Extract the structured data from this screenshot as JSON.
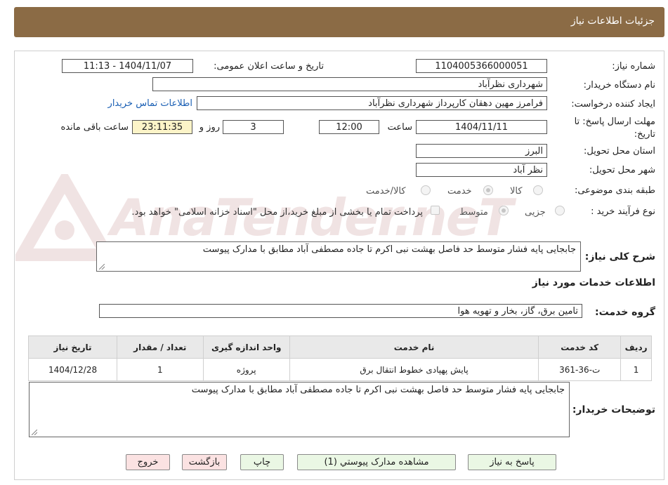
{
  "header": {
    "title": "جزئیات اطلاعات نیاز"
  },
  "form": {
    "need_number": {
      "label": "شماره نیاز:",
      "value": "1104005366000051"
    },
    "announce": {
      "label": "تاریخ و ساعت اعلان عمومی:",
      "value": "1404/11/07 - 11:13"
    },
    "buyer_org": {
      "label": "نام دستگاه خریدار:",
      "value": "شهرداری نظرآباد"
    },
    "requester": {
      "label": "ایجاد کننده درخواست:",
      "value": "فرامرز مهین دهقان کارپرداز شهرداری نظرآباد"
    },
    "contact_link": "اطلاعات تماس خریدار",
    "deadline": {
      "label_line1": "مهلت ارسال پاسخ: تا",
      "label_line2": "تاریخ:",
      "date": "1404/11/11",
      "time_label": "ساعت",
      "time": "12:00",
      "days": "3",
      "days_label": "روز و",
      "remaining": "23:11:35",
      "remaining_label": "ساعت باقی مانده"
    },
    "province": {
      "label": "استان محل تحویل:",
      "value": "البرز"
    },
    "city": {
      "label": "شهر محل تحویل:",
      "value": "نظر آباد"
    },
    "category": {
      "label": "طبقه بندی موضوعی:",
      "options": [
        "کالا",
        "خدمت",
        "کالا/خدمت"
      ],
      "selected": "خدمت"
    },
    "process": {
      "label": "نوع فرآیند خرید :",
      "options": [
        "جزیی",
        "متوسط"
      ],
      "selected": "متوسط",
      "payment_note": "پرداخت تمام یا بخشی از مبلغ خرید،از محل \"اسناد خزانه اسلامی\" خواهد بود."
    },
    "general_desc": {
      "label": "شرح کلی نیاز:",
      "value": "جابجایی پایه فشار متوسط حد فاصل بهشت نبی اکرم تا جاده مصطفی آباد مطابق با مدارک پیوست"
    }
  },
  "services": {
    "section_title": "اطلاعات خدمات مورد نیاز",
    "group_label": "گروه خدمت:",
    "group_value": "تامین برق، گاز، بخار و تهویه هوا",
    "columns": [
      "ردیف",
      "کد خدمت",
      "نام خدمت",
      "واحد اندازه گیری",
      "تعداد / مقدار",
      "تاریخ نیاز"
    ],
    "rows": [
      [
        "1",
        "ت-36-361",
        "پایش پهپادی خطوط انتقال برق",
        "پروژه",
        "1",
        "1404/12/28"
      ]
    ]
  },
  "buyer_notes": {
    "label": "توضیحات خریدار:",
    "value": "جابجایی پایه فشار متوسط حد فاصل بهشت نبی اکرم تا جاده مصطفی آباد مطابق با مدارک پیوست"
  },
  "buttons": {
    "reply": "پاسخ به نیاز",
    "attachments": "مشاهده مدارک پیوستي (1)",
    "print": "چاپ",
    "back": "بازگشت",
    "exit": "خروج"
  },
  "watermark": "AnaTender.neT",
  "colors": {
    "header": "#8b6b45",
    "button_green": "#eaf7e4",
    "button_pink": "#fbe2e2",
    "remaining_bg": "#fcf4c8",
    "link": "#1a5fb4"
  }
}
